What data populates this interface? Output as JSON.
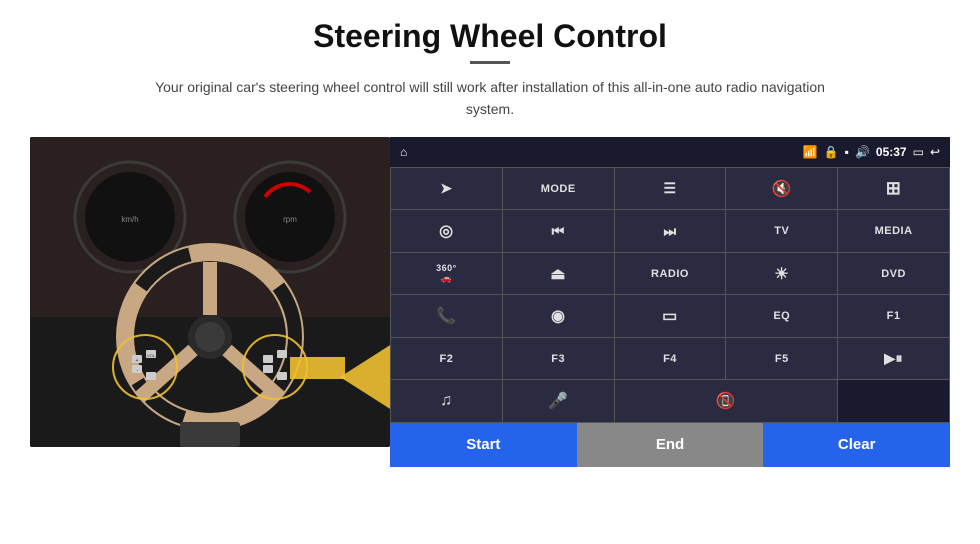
{
  "header": {
    "title": "Steering Wheel Control",
    "divider": true,
    "subtitle": "Your original car's steering wheel control will still work after installation of this all-in-one auto radio navigation system."
  },
  "statusbar": {
    "home_icon": "⌂",
    "wifi_icon": "📶",
    "lock_icon": "🔒",
    "sim_icon": "📱",
    "bt_icon": "🔊",
    "time": "05:37",
    "screen_icon": "▭",
    "back_icon": "↩"
  },
  "panel_buttons": [
    {
      "id": "send",
      "icon": "➤",
      "label": ""
    },
    {
      "id": "mode",
      "icon": "",
      "label": "MODE"
    },
    {
      "id": "list",
      "icon": "☰",
      "label": ""
    },
    {
      "id": "mute",
      "icon": "🔇",
      "label": ""
    },
    {
      "id": "apps",
      "icon": "⊞",
      "label": ""
    },
    {
      "id": "target",
      "icon": "◎",
      "label": ""
    },
    {
      "id": "prev",
      "icon": "⏮",
      "label": ""
    },
    {
      "id": "next",
      "icon": "⏭",
      "label": ""
    },
    {
      "id": "tv",
      "icon": "",
      "label": "TV"
    },
    {
      "id": "media",
      "icon": "",
      "label": "MEDIA"
    },
    {
      "id": "cam360",
      "icon": "360°",
      "label": ""
    },
    {
      "id": "eject",
      "icon": "⏏",
      "label": ""
    },
    {
      "id": "radio",
      "icon": "",
      "label": "RADIO"
    },
    {
      "id": "bright",
      "icon": "☀",
      "label": ""
    },
    {
      "id": "dvd",
      "icon": "",
      "label": "DVD"
    },
    {
      "id": "phone",
      "icon": "📞",
      "label": ""
    },
    {
      "id": "nav",
      "icon": "◎",
      "label": ""
    },
    {
      "id": "rect",
      "icon": "▭",
      "label": ""
    },
    {
      "id": "eq",
      "icon": "",
      "label": "EQ"
    },
    {
      "id": "f1",
      "icon": "",
      "label": "F1"
    },
    {
      "id": "f2",
      "icon": "",
      "label": "F2"
    },
    {
      "id": "f3",
      "icon": "",
      "label": "F3"
    },
    {
      "id": "f4",
      "icon": "",
      "label": "F4"
    },
    {
      "id": "f5",
      "icon": "",
      "label": "F5"
    },
    {
      "id": "playpause",
      "icon": "▶⏸",
      "label": ""
    },
    {
      "id": "music",
      "icon": "♫",
      "label": ""
    },
    {
      "id": "mic",
      "icon": "🎤",
      "label": ""
    },
    {
      "id": "hangup",
      "icon": "📵",
      "label": ""
    }
  ],
  "bottom_buttons": [
    {
      "id": "start",
      "label": "Start",
      "color": "#2563eb"
    },
    {
      "id": "end",
      "label": "End",
      "color": "#888888"
    },
    {
      "id": "clear",
      "label": "Clear",
      "color": "#2563eb"
    }
  ]
}
